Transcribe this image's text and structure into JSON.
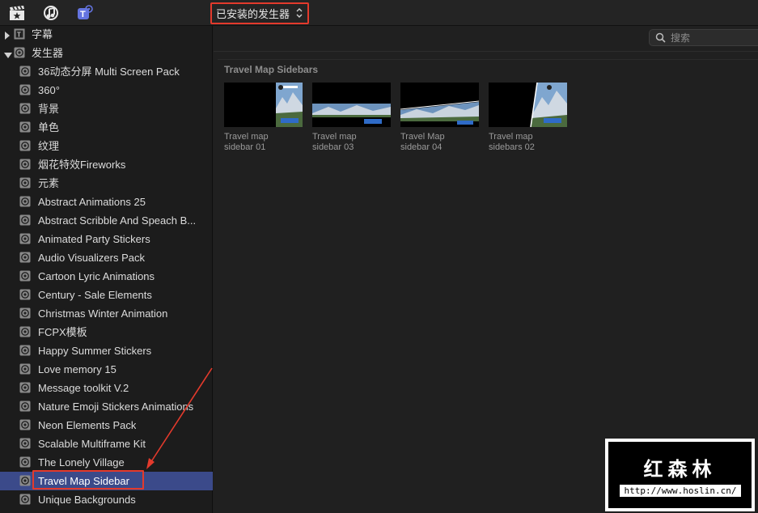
{
  "toolbar": {
    "source_selector": "已安装的发生器"
  },
  "sidebar": {
    "top_items": [
      {
        "label": "字幕",
        "expanded": false
      },
      {
        "label": "发生器",
        "expanded": true
      }
    ],
    "children": [
      "36动态分屏 Multi Screen Pack",
      "360°",
      "背景",
      "单色",
      "纹理",
      "烟花特效Fireworks",
      "元素",
      "Abstract Animations 25",
      "Abstract Scribble And Speach B...",
      "Animated Party Stickers",
      "Audio Visualizers Pack",
      "Cartoon Lyric Animations",
      "Century - Sale Elements",
      "Christmas Winter Animation",
      "FCPX模板",
      "Happy Summer Stickers",
      "Love memory 15",
      "Message toolkit V.2",
      "Nature Emoji Stickers Animations",
      "Neon Elements Pack",
      "Scalable Multiframe Kit",
      "The Lonely Village",
      "Travel Map Sidebar",
      "Unique Backgrounds"
    ],
    "selected_index": 22
  },
  "search": {
    "placeholder": "搜索"
  },
  "browser": {
    "section_title": "Travel Map Sidebars",
    "clips": [
      {
        "line1": "Travel map",
        "line2": "sidebar 01"
      },
      {
        "line1": "Travel map",
        "line2": "sidebar 03"
      },
      {
        "line1": "Travel Map",
        "line2": "sidebar 04"
      },
      {
        "line1": "Travel map",
        "line2": "sidebars 02"
      }
    ]
  },
  "watermark": {
    "title": "红森林",
    "url": "http://www.hoslin.cn/"
  },
  "colors": {
    "highlight_red": "#e33a2c",
    "selection_blue": "#3b4a8a",
    "sky_blue": "#5d87b5"
  }
}
